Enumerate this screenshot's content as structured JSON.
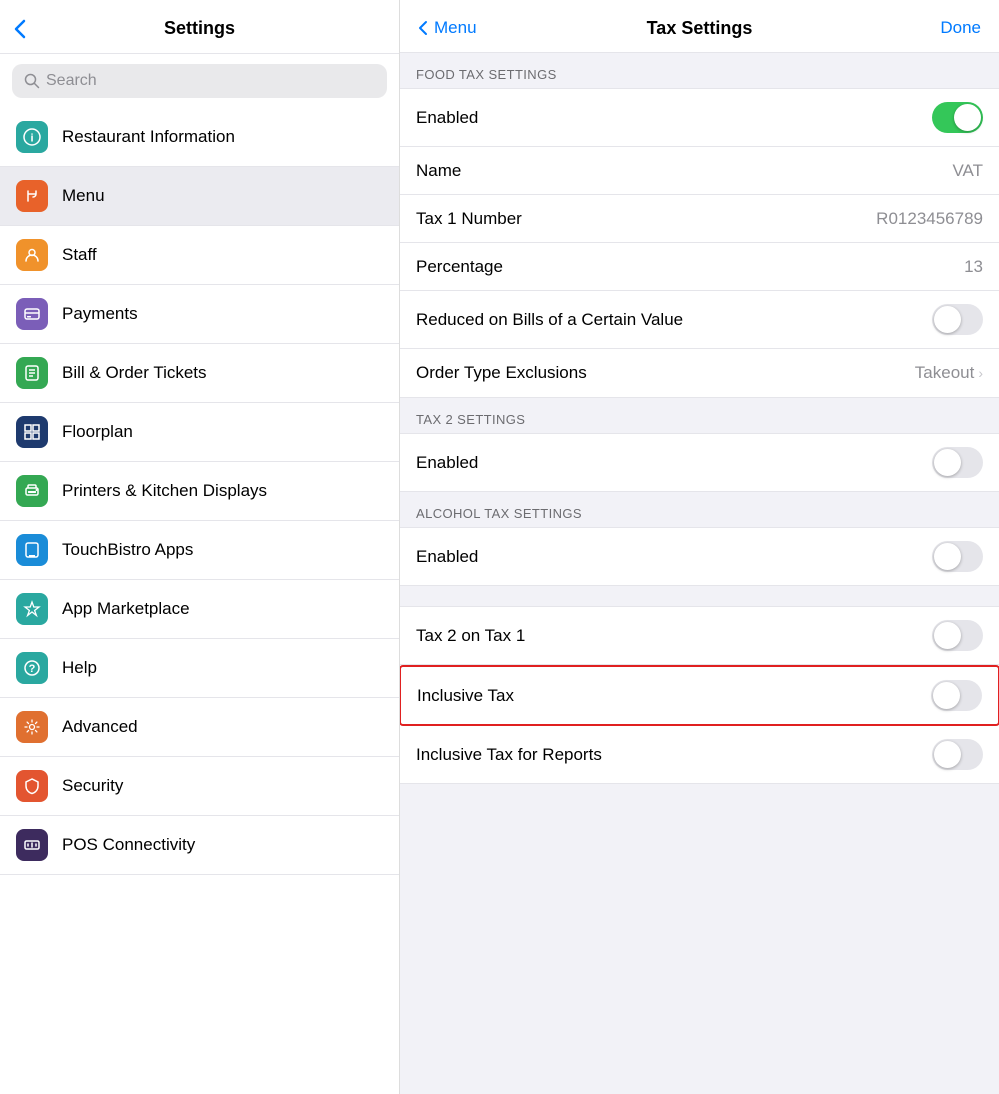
{
  "leftPanel": {
    "header": {
      "backIcon": "‹",
      "title": "Settings"
    },
    "search": {
      "placeholder": "Search"
    },
    "menuItems": [
      {
        "id": "restaurant-information",
        "label": "Restaurant Information",
        "iconColor": "#2aa8a0",
        "iconChar": "ℹ",
        "active": false
      },
      {
        "id": "menu",
        "label": "Menu",
        "iconColor": "#e8622a",
        "iconChar": "🍴",
        "active": true
      },
      {
        "id": "staff",
        "label": "Staff",
        "iconColor": "#f0922b",
        "iconChar": "👤",
        "active": false
      },
      {
        "id": "payments",
        "label": "Payments",
        "iconColor": "#7b5eb8",
        "iconChar": "▦",
        "active": false
      },
      {
        "id": "bill-order-tickets",
        "label": "Bill & Order Tickets",
        "iconColor": "#34a853",
        "iconChar": "🗒",
        "active": false
      },
      {
        "id": "floorplan",
        "label": "Floorplan",
        "iconColor": "#1e3a6e",
        "iconChar": "▦",
        "active": false
      },
      {
        "id": "printers-kitchen",
        "label": "Printers & Kitchen Displays",
        "iconColor": "#34a853",
        "iconChar": "🖨",
        "active": false
      },
      {
        "id": "touchbistro-apps",
        "label": "TouchBistro Apps",
        "iconColor": "#1a8cd8",
        "iconChar": "▣",
        "active": false
      },
      {
        "id": "app-marketplace",
        "label": "App Marketplace",
        "iconColor": "#2aa8a0",
        "iconChar": "✦",
        "active": false
      },
      {
        "id": "help",
        "label": "Help",
        "iconColor": "#2aa8a0",
        "iconChar": "?",
        "active": false
      },
      {
        "id": "advanced",
        "label": "Advanced",
        "iconColor": "#e8622a",
        "iconChar": "⚙",
        "active": false
      },
      {
        "id": "security",
        "label": "Security",
        "iconColor": "#e8622a",
        "iconChar": "🛡",
        "active": false
      },
      {
        "id": "pos-connectivity",
        "label": "POS Connectivity",
        "iconColor": "#3d2b5e",
        "iconChar": "⊞",
        "active": false
      }
    ]
  },
  "rightPanel": {
    "header": {
      "backLabel": "Menu",
      "title": "Tax Settings",
      "doneLabel": "Done"
    },
    "sections": [
      {
        "id": "food-tax",
        "sectionHeader": "FOOD TAX SETTINGS",
        "rows": [
          {
            "id": "food-enabled",
            "label": "Enabled",
            "type": "toggle",
            "toggleOn": true,
            "highlighted": false
          },
          {
            "id": "food-name",
            "label": "Name",
            "type": "value",
            "value": "VAT",
            "highlighted": false
          },
          {
            "id": "food-tax1number",
            "label": "Tax 1 Number",
            "type": "value",
            "value": "R0123456789",
            "highlighted": false
          },
          {
            "id": "food-percentage",
            "label": "Percentage",
            "type": "value",
            "value": "13",
            "highlighted": false
          },
          {
            "id": "food-reduced",
            "label": "Reduced on Bills of a Certain Value",
            "type": "toggle",
            "toggleOn": false,
            "highlighted": false
          },
          {
            "id": "food-order-exclusions",
            "label": "Order Type Exclusions",
            "type": "nav",
            "value": "Takeout",
            "highlighted": false
          }
        ]
      },
      {
        "id": "tax2",
        "sectionHeader": "TAX 2 SETTINGS",
        "rows": [
          {
            "id": "tax2-enabled",
            "label": "Enabled",
            "type": "toggle",
            "toggleOn": false,
            "highlighted": false
          }
        ]
      },
      {
        "id": "alcohol-tax",
        "sectionHeader": "ALCOHOL TAX SETTINGS",
        "rows": [
          {
            "id": "alcohol-enabled",
            "label": "Enabled",
            "type": "toggle",
            "toggleOn": false,
            "highlighted": false
          }
        ]
      },
      {
        "id": "general",
        "sectionHeader": "",
        "rows": [
          {
            "id": "tax2-on-tax1",
            "label": "Tax 2 on Tax 1",
            "type": "toggle",
            "toggleOn": false,
            "highlighted": false
          },
          {
            "id": "inclusive-tax",
            "label": "Inclusive Tax",
            "type": "toggle",
            "toggleOn": false,
            "highlighted": true
          },
          {
            "id": "inclusive-tax-reports",
            "label": "Inclusive Tax for Reports",
            "type": "toggle",
            "toggleOn": false,
            "highlighted": false
          }
        ]
      }
    ]
  },
  "icons": {
    "backChevron": "❮",
    "chevronRight": "›",
    "searchMagnifier": "⌕"
  }
}
